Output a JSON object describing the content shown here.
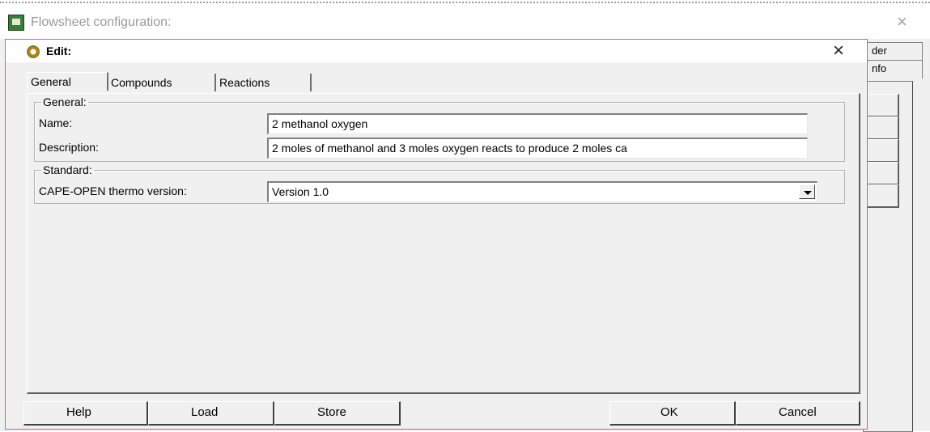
{
  "outer_window": {
    "title": "Flowsheet configuration:",
    "close_glyph": "×",
    "tabs": [
      "der",
      "nfo"
    ]
  },
  "dialog": {
    "title": "Edit:",
    "close_glyph": "×",
    "tabs": [
      "General",
      "Compounds",
      "Reactions"
    ],
    "active_tab": "General",
    "general_group": {
      "legend": "General:",
      "name_label": "Name:",
      "name_value": "2 methanol oxygen",
      "description_label": "Description:",
      "description_value": "2 moles of methanol and 3 moles oxygen reacts to produce 2 moles ca"
    },
    "standard_group": {
      "legend": "Standard:",
      "version_label": "CAPE-OPEN thermo version:",
      "version_value": "Version 1.0"
    },
    "buttons": {
      "help": "Help",
      "load": "Load",
      "store": "Store",
      "ok": "OK",
      "cancel": "Cancel"
    }
  },
  "colors": {
    "dialog_border": "#d65aa0",
    "window_bg": "#f0f0f0"
  }
}
